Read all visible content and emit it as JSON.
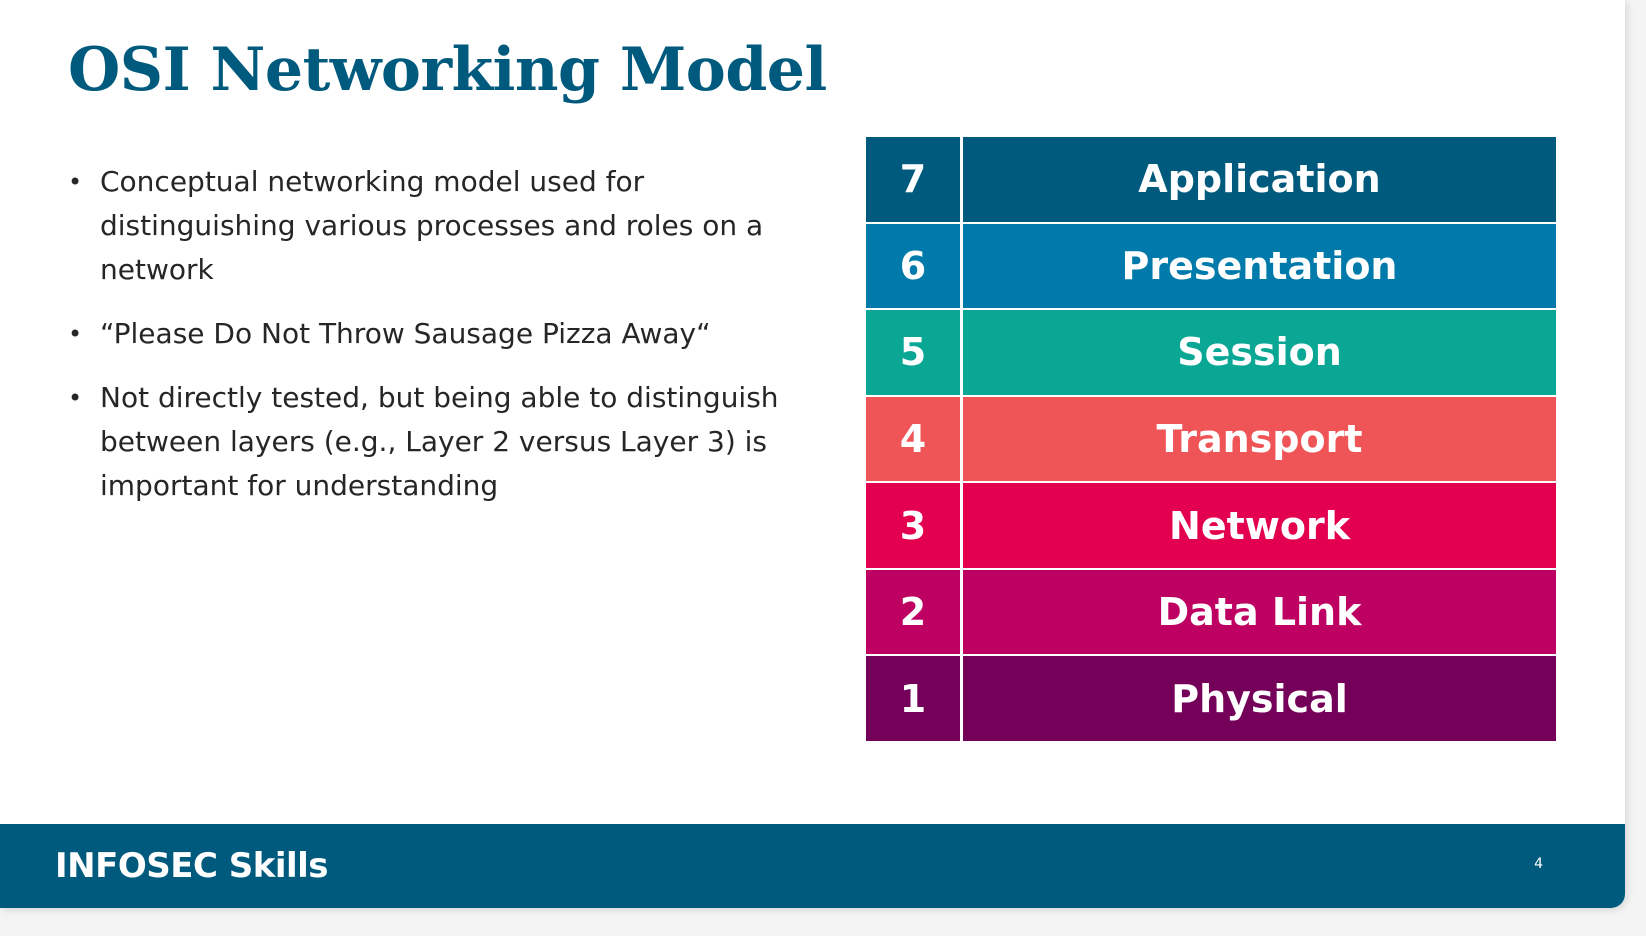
{
  "slide": {
    "title": "OSI Networking Model",
    "bullets": [
      "Conceptual networking model used for distinguishing various processes and roles on a network",
      "“Please Do Not Throw Sausage Pizza Away“",
      "Not directly tested, but being able to distinguish between layers (e.g., Layer 2 versus Layer 3) is important for understanding"
    ],
    "bullet_marker": "•",
    "layers": [
      {
        "number": "7",
        "name": "Application",
        "color": "#005a7d"
      },
      {
        "number": "6",
        "name": "Presentation",
        "color": "#007aab"
      },
      {
        "number": "5",
        "name": "Session",
        "color": "#0aa795"
      },
      {
        "number": "4",
        "name": "Transport",
        "color": "#ef5457"
      },
      {
        "number": "3",
        "name": "Network",
        "color": "#e2004f"
      },
      {
        "number": "2",
        "name": "Data Link",
        "color": "#be0062"
      },
      {
        "number": "1",
        "name": "Physical",
        "color": "#750059"
      }
    ]
  },
  "footer": {
    "brand": "INFOSEC Skills",
    "page_number": "4",
    "color": "#005a7d"
  }
}
